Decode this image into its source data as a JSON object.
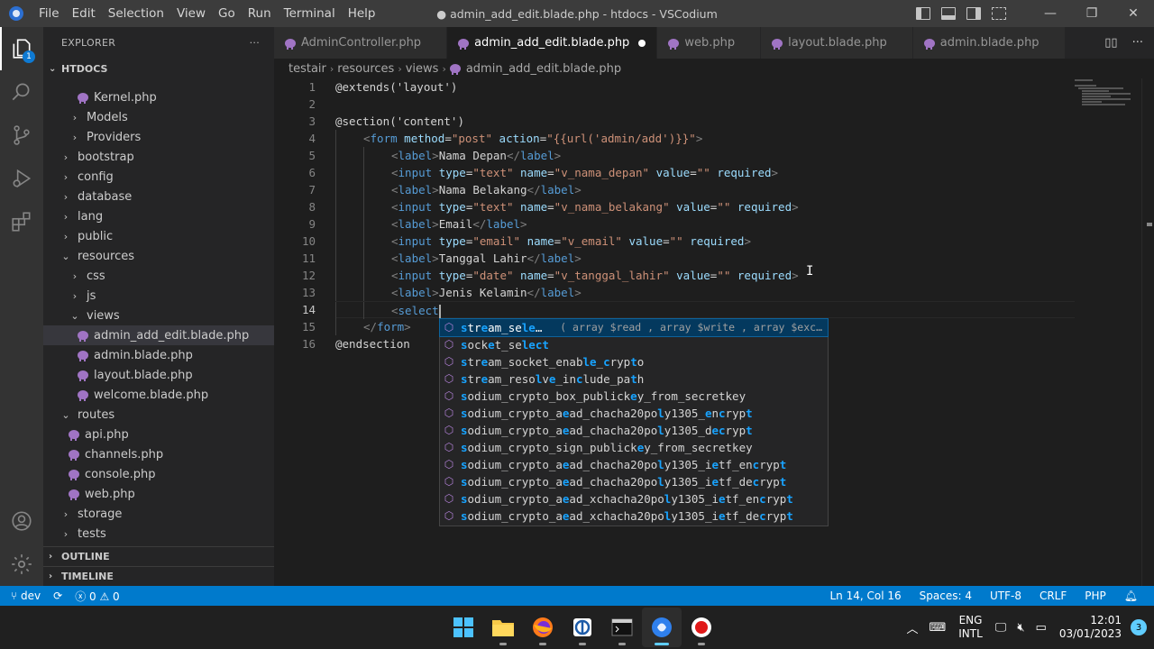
{
  "window": {
    "title": "● admin_add_edit.blade.php - htdocs - VSCodium",
    "menu": [
      "File",
      "Edit",
      "Selection",
      "View",
      "Go",
      "Run",
      "Terminal",
      "Help"
    ]
  },
  "activity": {
    "items": [
      "explorer-icon",
      "search-icon",
      "source-control-icon",
      "run-debug-icon",
      "extensions-icon"
    ],
    "explorer_badge": "1",
    "bottom": [
      "account-icon",
      "settings-gear-icon"
    ]
  },
  "sidebar": {
    "title": "EXPLORER",
    "more": "···",
    "root": "HTDOCS",
    "tree": [
      {
        "label": "Kernel.php",
        "kind": "file",
        "indent": 3
      },
      {
        "label": "Models",
        "kind": "folder",
        "open": false,
        "indent": 2
      },
      {
        "label": "Providers",
        "kind": "folder",
        "open": false,
        "indent": 2
      },
      {
        "label": "bootstrap",
        "kind": "folder",
        "open": false,
        "indent": 1
      },
      {
        "label": "config",
        "kind": "folder",
        "open": false,
        "indent": 1
      },
      {
        "label": "database",
        "kind": "folder",
        "open": false,
        "indent": 1
      },
      {
        "label": "lang",
        "kind": "folder",
        "open": false,
        "indent": 1
      },
      {
        "label": "public",
        "kind": "folder",
        "open": false,
        "indent": 1
      },
      {
        "label": "resources",
        "kind": "folder",
        "open": true,
        "indent": 1
      },
      {
        "label": "css",
        "kind": "folder",
        "open": false,
        "indent": 2
      },
      {
        "label": "js",
        "kind": "folder",
        "open": false,
        "indent": 2
      },
      {
        "label": "views",
        "kind": "folder",
        "open": true,
        "indent": 2
      },
      {
        "label": "admin_add_edit.blade.php",
        "kind": "file",
        "indent": 3,
        "selected": true
      },
      {
        "label": "admin.blade.php",
        "kind": "file",
        "indent": 3
      },
      {
        "label": "layout.blade.php",
        "kind": "file",
        "indent": 3
      },
      {
        "label": "welcome.blade.php",
        "kind": "file",
        "indent": 3
      },
      {
        "label": "routes",
        "kind": "folder",
        "open": true,
        "indent": 1
      },
      {
        "label": "api.php",
        "kind": "file",
        "indent": 2
      },
      {
        "label": "channels.php",
        "kind": "file",
        "indent": 2
      },
      {
        "label": "console.php",
        "kind": "file",
        "indent": 2
      },
      {
        "label": "web.php",
        "kind": "file",
        "indent": 2
      },
      {
        "label": "storage",
        "kind": "folder",
        "open": false,
        "indent": 1
      },
      {
        "label": "tests",
        "kind": "folder",
        "open": false,
        "indent": 1
      }
    ],
    "outline": "OUTLINE",
    "timeline": "TIMELINE"
  },
  "tabs": [
    {
      "label": "AdminController.php",
      "active": false
    },
    {
      "label": "admin_add_edit.blade.php",
      "active": true,
      "dirty": true
    },
    {
      "label": "web.php",
      "active": false
    },
    {
      "label": "layout.blade.php",
      "active": false
    },
    {
      "label": "admin.blade.php",
      "active": false
    }
  ],
  "breadcrumb": [
    "testair",
    "resources",
    "views",
    "admin_add_edit.blade.php"
  ],
  "editor": {
    "current_line": 14,
    "lines": [
      {
        "n": "1",
        "indent": 0,
        "parts": [
          [
            "tx",
            "@extends('layout')"
          ]
        ]
      },
      {
        "n": "2",
        "indent": 0,
        "parts": []
      },
      {
        "n": "3",
        "indent": 0,
        "parts": [
          [
            "tx",
            "@section('content')"
          ]
        ]
      },
      {
        "n": "4",
        "indent": 1,
        "parts": [
          [
            "tg",
            "<"
          ],
          [
            "tn",
            "form"
          ],
          [
            "tx",
            " "
          ],
          [
            "at",
            "method"
          ],
          [
            "tx",
            "="
          ],
          [
            "st",
            "\"post\""
          ],
          [
            "tx",
            " "
          ],
          [
            "at",
            "action"
          ],
          [
            "tx",
            "="
          ],
          [
            "st",
            "\"{{url('admin/add')}}\""
          ],
          [
            "tg",
            ">"
          ]
        ]
      },
      {
        "n": "5",
        "indent": 2,
        "parts": [
          [
            "tg",
            "<"
          ],
          [
            "tn",
            "label"
          ],
          [
            "tg",
            ">"
          ],
          [
            "tx",
            "Nama Depan"
          ],
          [
            "tg",
            "</"
          ],
          [
            "tn",
            "label"
          ],
          [
            "tg",
            ">"
          ]
        ]
      },
      {
        "n": "6",
        "indent": 2,
        "parts": [
          [
            "tg",
            "<"
          ],
          [
            "tn",
            "input"
          ],
          [
            "tx",
            " "
          ],
          [
            "at",
            "type"
          ],
          [
            "tx",
            "="
          ],
          [
            "st",
            "\"text\""
          ],
          [
            "tx",
            " "
          ],
          [
            "at",
            "name"
          ],
          [
            "tx",
            "="
          ],
          [
            "st",
            "\"v_nama_depan\""
          ],
          [
            "tx",
            " "
          ],
          [
            "at",
            "value"
          ],
          [
            "tx",
            "="
          ],
          [
            "st",
            "\"\""
          ],
          [
            "tx",
            " "
          ],
          [
            "at",
            "required"
          ],
          [
            "tg",
            ">"
          ]
        ]
      },
      {
        "n": "7",
        "indent": 2,
        "parts": [
          [
            "tg",
            "<"
          ],
          [
            "tn",
            "label"
          ],
          [
            "tg",
            ">"
          ],
          [
            "tx",
            "Nama Belakang"
          ],
          [
            "tg",
            "</"
          ],
          [
            "tn",
            "label"
          ],
          [
            "tg",
            ">"
          ]
        ]
      },
      {
        "n": "8",
        "indent": 2,
        "parts": [
          [
            "tg",
            "<"
          ],
          [
            "tn",
            "input"
          ],
          [
            "tx",
            " "
          ],
          [
            "at",
            "type"
          ],
          [
            "tx",
            "="
          ],
          [
            "st",
            "\"text\""
          ],
          [
            "tx",
            " "
          ],
          [
            "at",
            "name"
          ],
          [
            "tx",
            "="
          ],
          [
            "st",
            "\"v_nama_belakang\""
          ],
          [
            "tx",
            " "
          ],
          [
            "at",
            "value"
          ],
          [
            "tx",
            "="
          ],
          [
            "st",
            "\"\""
          ],
          [
            "tx",
            " "
          ],
          [
            "at",
            "required"
          ],
          [
            "tg",
            ">"
          ]
        ]
      },
      {
        "n": "9",
        "indent": 2,
        "parts": [
          [
            "tg",
            "<"
          ],
          [
            "tn",
            "label"
          ],
          [
            "tg",
            ">"
          ],
          [
            "tx",
            "Email"
          ],
          [
            "tg",
            "</"
          ],
          [
            "tn",
            "label"
          ],
          [
            "tg",
            ">"
          ]
        ]
      },
      {
        "n": "10",
        "indent": 2,
        "parts": [
          [
            "tg",
            "<"
          ],
          [
            "tn",
            "input"
          ],
          [
            "tx",
            " "
          ],
          [
            "at",
            "type"
          ],
          [
            "tx",
            "="
          ],
          [
            "st",
            "\"email\""
          ],
          [
            "tx",
            " "
          ],
          [
            "at",
            "name"
          ],
          [
            "tx",
            "="
          ],
          [
            "st",
            "\"v_email\""
          ],
          [
            "tx",
            " "
          ],
          [
            "at",
            "value"
          ],
          [
            "tx",
            "="
          ],
          [
            "st",
            "\"\""
          ],
          [
            "tx",
            " "
          ],
          [
            "at",
            "required"
          ],
          [
            "tg",
            ">"
          ]
        ]
      },
      {
        "n": "11",
        "indent": 2,
        "parts": [
          [
            "tg",
            "<"
          ],
          [
            "tn",
            "label"
          ],
          [
            "tg",
            ">"
          ],
          [
            "tx",
            "Tanggal Lahir"
          ],
          [
            "tg",
            "</"
          ],
          [
            "tn",
            "label"
          ],
          [
            "tg",
            ">"
          ]
        ]
      },
      {
        "n": "12",
        "indent": 2,
        "parts": [
          [
            "tg",
            "<"
          ],
          [
            "tn",
            "input"
          ],
          [
            "tx",
            " "
          ],
          [
            "at",
            "type"
          ],
          [
            "tx",
            "="
          ],
          [
            "st",
            "\"date\""
          ],
          [
            "tx",
            " "
          ],
          [
            "at",
            "name"
          ],
          [
            "tx",
            "="
          ],
          [
            "st",
            "\"v_tanggal_lahir\""
          ],
          [
            "tx",
            " "
          ],
          [
            "at",
            "value"
          ],
          [
            "tx",
            "="
          ],
          [
            "st",
            "\"\""
          ],
          [
            "tx",
            " "
          ],
          [
            "at",
            "required"
          ],
          [
            "tg",
            ">"
          ]
        ]
      },
      {
        "n": "13",
        "indent": 2,
        "parts": [
          [
            "tg",
            "<"
          ],
          [
            "tn",
            "label"
          ],
          [
            "tg",
            ">"
          ],
          [
            "tx",
            "Jenis Kelamin"
          ],
          [
            "tg",
            "</"
          ],
          [
            "tn",
            "label"
          ],
          [
            "tg",
            ">"
          ]
        ]
      },
      {
        "n": "14",
        "indent": 2,
        "parts": [
          [
            "tg",
            "<"
          ],
          [
            "tn",
            "select"
          ]
        ],
        "caret": true
      },
      {
        "n": "15",
        "indent": 1,
        "parts": [
          [
            "tg",
            "</"
          ],
          [
            "tn",
            "form"
          ],
          [
            "tg",
            ">"
          ]
        ]
      },
      {
        "n": "16",
        "indent": 0,
        "parts": [
          [
            "tx",
            "@endsection"
          ]
        ]
      }
    ]
  },
  "suggest": {
    "items": [
      {
        "label": "stream_sele…",
        "detail": "( array $read , array $write , array $exc…",
        "focused": true
      },
      {
        "label": "socket_select"
      },
      {
        "label": "stream_socket_enable_crypto"
      },
      {
        "label": "stream_resolve_include_path"
      },
      {
        "label": "sodium_crypto_box_publickey_from_secretkey"
      },
      {
        "label": "sodium_crypto_aead_chacha20poly1305_encrypt"
      },
      {
        "label": "sodium_crypto_aead_chacha20poly1305_decrypt"
      },
      {
        "label": "sodium_crypto_sign_publickey_from_secretkey"
      },
      {
        "label": "sodium_crypto_aead_chacha20poly1305_ietf_encrypt"
      },
      {
        "label": "sodium_crypto_aead_chacha20poly1305_ietf_decrypt"
      },
      {
        "label": "sodium_crypto_aead_xchacha20poly1305_ietf_encrypt"
      },
      {
        "label": "sodium_crypto_aead_xchacha20poly1305_ietf_decrypt"
      }
    ],
    "query": "select"
  },
  "statusbar": {
    "branch": "dev",
    "errors": "0",
    "warnings": "0",
    "position": "Ln 14, Col 16",
    "spaces": "Spaces: 4",
    "encoding": "UTF-8",
    "eol": "CRLF",
    "language": "PHP"
  },
  "taskbar": {
    "apps": [
      "windows-start-icon",
      "file-explorer-icon",
      "firefox-icon",
      "xampp-icon",
      "terminal-icon",
      "vscodium-icon",
      "obs-record-icon"
    ],
    "lang_top": "ENG",
    "lang_bottom": "INTL",
    "time": "12:01",
    "date": "03/01/2023",
    "notifications": "3"
  },
  "colors": {
    "accent": "#007acc",
    "titlebar": "#3c3c3c",
    "sidebar": "#252526",
    "editor": "#1e1e1e"
  }
}
